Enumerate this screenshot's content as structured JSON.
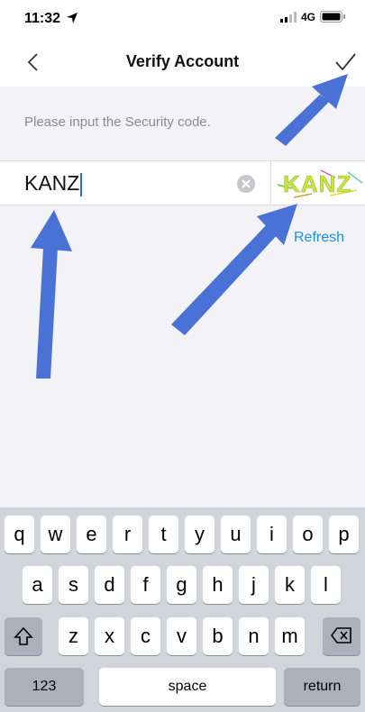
{
  "status_bar": {
    "time": "11:32",
    "network": "4G"
  },
  "nav": {
    "title": "Verify Account",
    "back_icon": "chevron-left-icon",
    "confirm_icon": "checkmark-icon"
  },
  "form": {
    "hint": "Please input the Security code.",
    "code_value": "KANZ",
    "clear_icon": "clear-circle-icon",
    "captcha_text": "KANZ",
    "refresh_label": "Refresh"
  },
  "keyboard": {
    "row1": [
      "q",
      "w",
      "e",
      "r",
      "t",
      "y",
      "u",
      "i",
      "o",
      "p"
    ],
    "row2": [
      "a",
      "s",
      "d",
      "f",
      "g",
      "h",
      "j",
      "k",
      "l"
    ],
    "row3": [
      "z",
      "x",
      "c",
      "v",
      "b",
      "n",
      "m"
    ],
    "numbers_label": "123",
    "space_label": "space",
    "return_label": "return",
    "shift_icon": "shift-icon",
    "delete_icon": "backspace-icon"
  },
  "colors": {
    "accent_blue": "#1e8ff0",
    "arrow_blue": "#4a72d6"
  }
}
